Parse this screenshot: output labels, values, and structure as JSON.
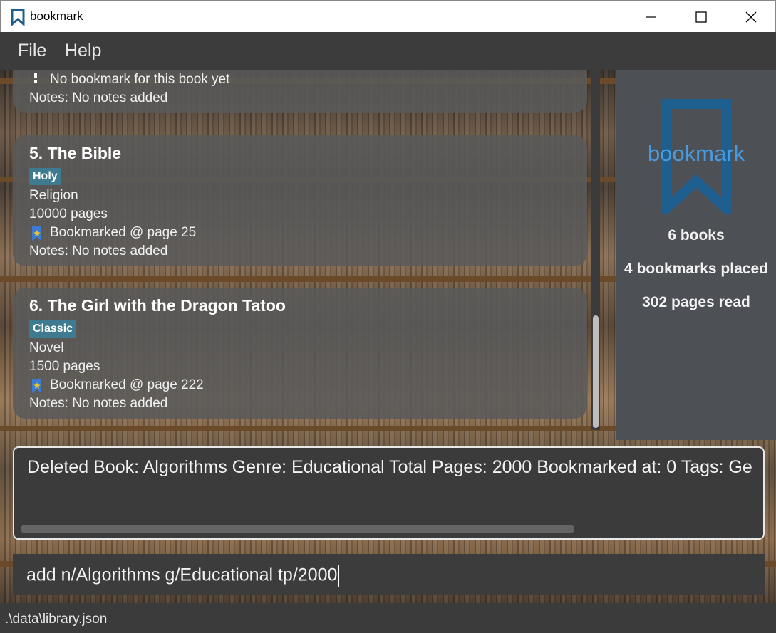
{
  "window": {
    "title": "bookmark",
    "icon": "bookmark-icon"
  },
  "menu": {
    "file": "File",
    "help": "Help"
  },
  "books": {
    "partial": {
      "bookmark_text": "No bookmark for this book yet",
      "notes": "Notes: No notes added"
    },
    "items": [
      {
        "name": "5.  The Bible",
        "tag": "Holy",
        "genre": "Religion",
        "pages": "10000 pages",
        "bookmark": "Bookmarked @ page 25",
        "notes": "Notes: No notes added"
      },
      {
        "name": "6.  The Girl with the Dragon Tatoo",
        "tag": "Classic",
        "genre": "Novel",
        "pages": "1500 pages",
        "bookmark": "Bookmarked @ page 222",
        "notes": "Notes: No notes added"
      }
    ]
  },
  "stats": {
    "logo_text": "bookmark",
    "books": "6 books",
    "bookmarks": "4 bookmarks placed",
    "pages_read": "302 pages read"
  },
  "result": {
    "text": "Deleted Book: Algorithms Genre: Educational Total Pages: 2000 Bookmarked at: 0 Tags:  Ge"
  },
  "command": {
    "value": "add n/Algorithms g/Educational tp/2000"
  },
  "status": {
    "path": ".\\data\\library.json"
  },
  "colors": {
    "accent": "#3e7b91",
    "logo": "#1f5f8f",
    "logo_text": "#4a9ae0"
  }
}
